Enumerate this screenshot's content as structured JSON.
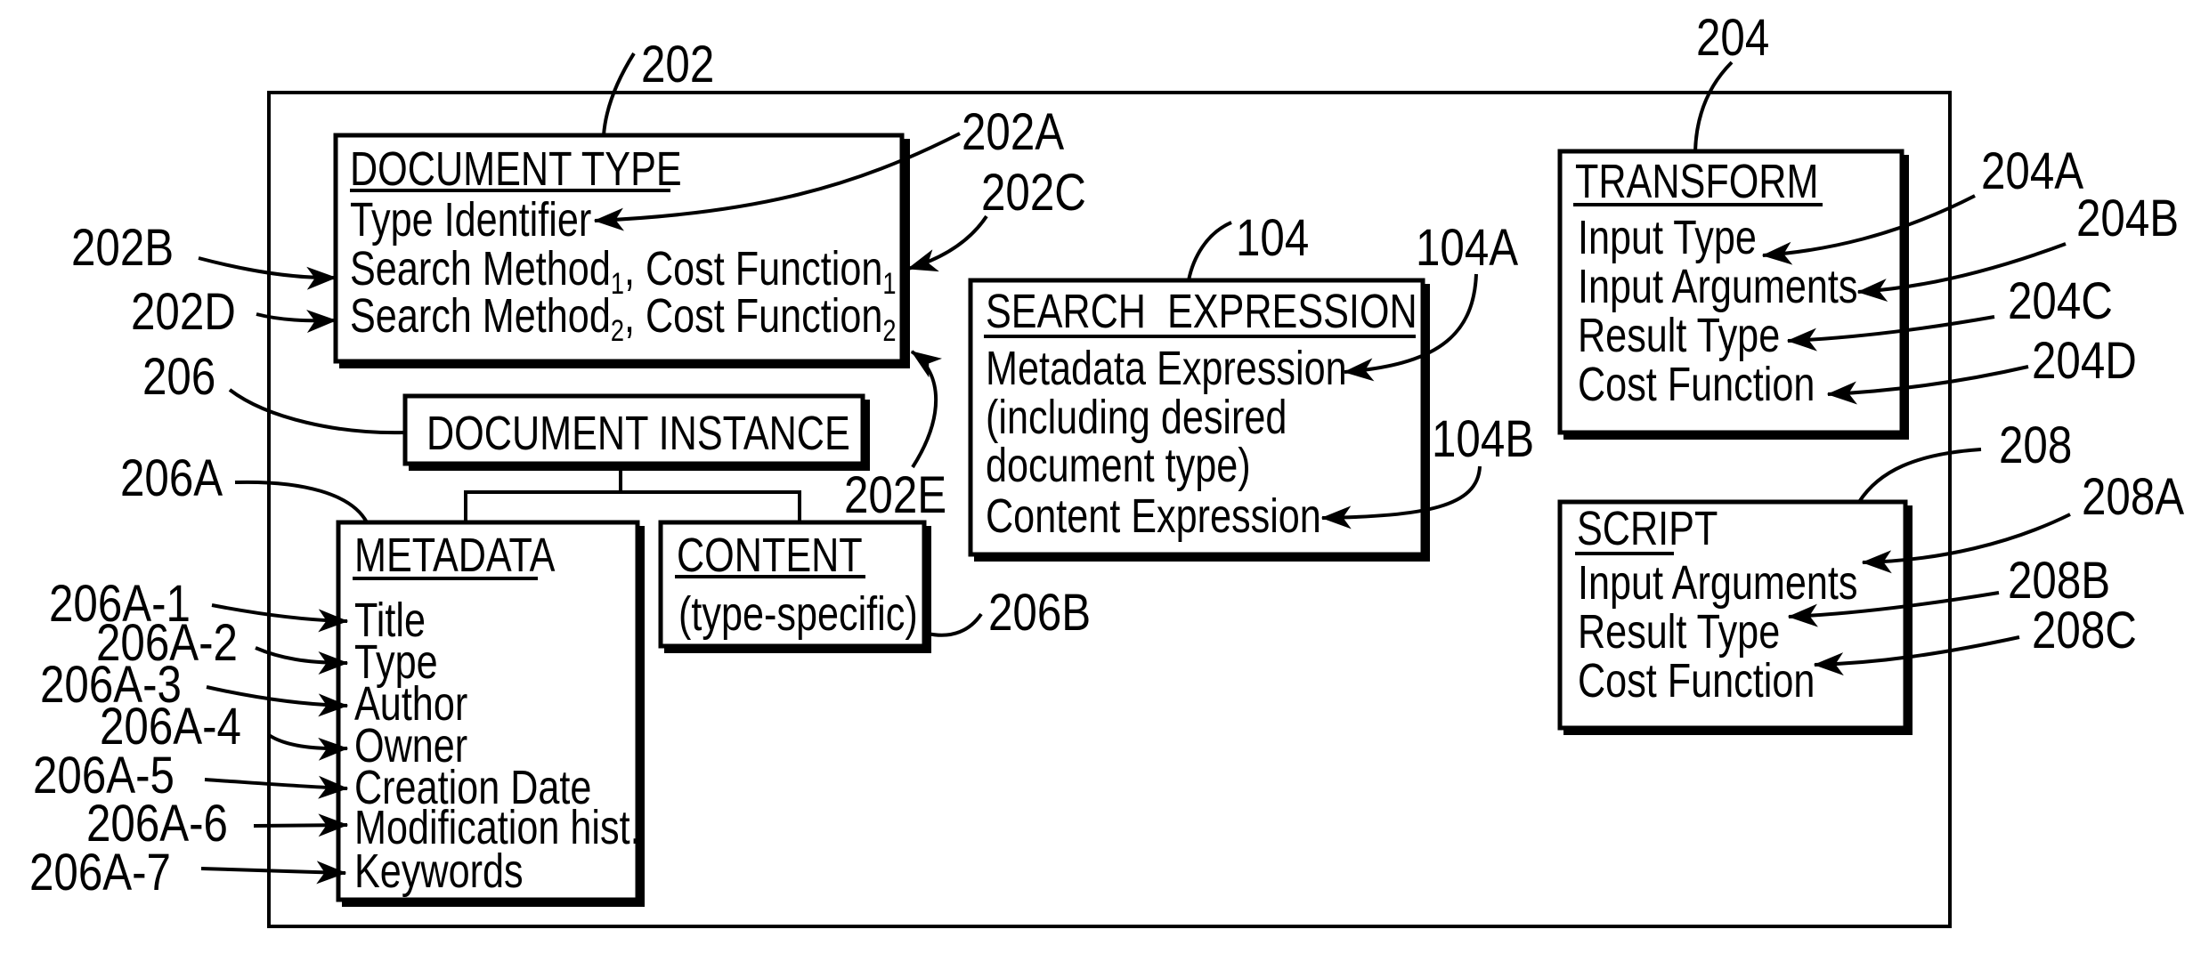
{
  "figure": {
    "description": "Patent-style block diagram of document type, document instance, search expression, transform and script data structures",
    "colors": {
      "ink": "#000000",
      "paper": "#ffffff"
    }
  },
  "boxes": {
    "document_type": {
      "ref": "202",
      "title": "DOCUMENT TYPE",
      "lines": [
        {
          "text": "Type Identifier",
          "ref": "202A"
        },
        {
          "text": "Search Method",
          "sub1": "1",
          "mid": ", Cost Function",
          "sub2": "1",
          "ref": "202B",
          "ref2": "202C"
        },
        {
          "text": "Search Method",
          "sub1": "2",
          "mid": ", Cost Function",
          "sub2": "2",
          "ref": "202D",
          "ref2": "202E"
        }
      ]
    },
    "document_instance": {
      "ref": "206",
      "title": "DOCUMENT INSTANCE"
    },
    "metadata": {
      "ref": "206A",
      "title": "METADATA",
      "items": [
        {
          "text": "Title",
          "ref": "206A-1"
        },
        {
          "text": "Type",
          "ref": "206A-2"
        },
        {
          "text": "Author",
          "ref": "206A-3"
        },
        {
          "text": "Owner",
          "ref": "206A-4"
        },
        {
          "text": "Creation Date",
          "ref": "206A-5"
        },
        {
          "text": "Modification hist.",
          "ref": "206A-6"
        },
        {
          "text": "Keywords",
          "ref": "206A-7"
        }
      ]
    },
    "content": {
      "ref": "206B",
      "title": "CONTENT",
      "lines": [
        "(type-specific)"
      ]
    },
    "search_expression": {
      "ref": "104",
      "title": "SEARCH  EXPRESSION",
      "lines": [
        {
          "text": "Metadata Expression",
          "ref": "104A"
        },
        {
          "text": "(including desired"
        },
        {
          "text": "document type)"
        },
        {
          "text": "Content Expression",
          "ref": "104B"
        }
      ]
    },
    "transform": {
      "ref": "204",
      "title": "TRANSFORM",
      "lines": [
        {
          "text": "Input Type",
          "ref": "204A"
        },
        {
          "text": "Input Arguments",
          "ref": "204B"
        },
        {
          "text": "Result Type",
          "ref": "204C"
        },
        {
          "text": "Cost Function",
          "ref": "204D"
        }
      ]
    },
    "script": {
      "ref": "208",
      "title": "SCRIPT",
      "lines": [
        {
          "text": "Input Arguments",
          "ref": "208A"
        },
        {
          "text": "Result Type",
          "ref": "208B"
        },
        {
          "text": "Cost Function",
          "ref": "208C"
        }
      ]
    }
  }
}
